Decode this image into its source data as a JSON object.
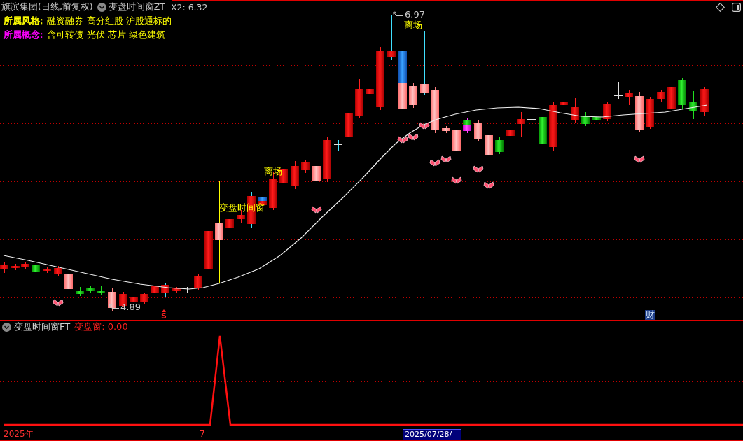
{
  "header": {
    "security": "旗滨集团(日线,前复权)",
    "indicator": "变盘时间窗ZT",
    "reading": "X2: 6.32"
  },
  "info_rows": [
    {
      "label": "所属风格:",
      "value": "融资融券 高分红股 沪股通标的",
      "color": "#ffff00"
    },
    {
      "label": "所属概念:",
      "value": "含可转债 光伏 芯片 绿色建筑",
      "color": "#ff00ff"
    }
  ],
  "price_chart": {
    "annotations": [
      {
        "kind": "high",
        "text": "6.97"
      },
      {
        "kind": "exit",
        "text": "离场"
      },
      {
        "kind": "exit",
        "text": "离场"
      },
      {
        "kind": "window",
        "text": "变盘时间窗"
      },
      {
        "kind": "low",
        "text": "4.89"
      },
      {
        "kind": "sell",
        "text": "S"
      },
      {
        "kind": "finance",
        "text": "财"
      }
    ]
  },
  "indicator_panel": {
    "title": "变盘时间窗FT",
    "reading": "变盘窗: 0.00"
  },
  "time_axis": {
    "labels": [
      "2025年",
      "7"
    ],
    "cursor_date": "2025/07/28/—"
  }
}
